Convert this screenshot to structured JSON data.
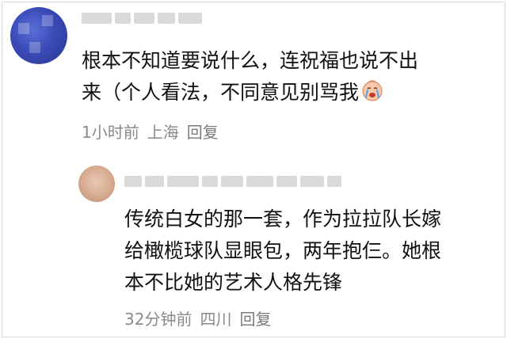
{
  "comments": [
    {
      "text_line1": "根本不知道要说什么，连祝福也说不出",
      "text_line2": "来（个人看法，不同意见别骂我",
      "emoji": "crying-face-icon",
      "time": "1小时前",
      "location": "上海",
      "reply_label": "回复"
    }
  ],
  "replies": [
    {
      "text_line1": "传统白女的那一套，作为拉拉队长嫁",
      "text_line2": "给橄榄球队显眼包，两年抱仨。她根",
      "text_line3": "本不比她的艺术人格先锋",
      "time": "32分钟前",
      "location": "四川",
      "reply_label": "回复"
    }
  ]
}
